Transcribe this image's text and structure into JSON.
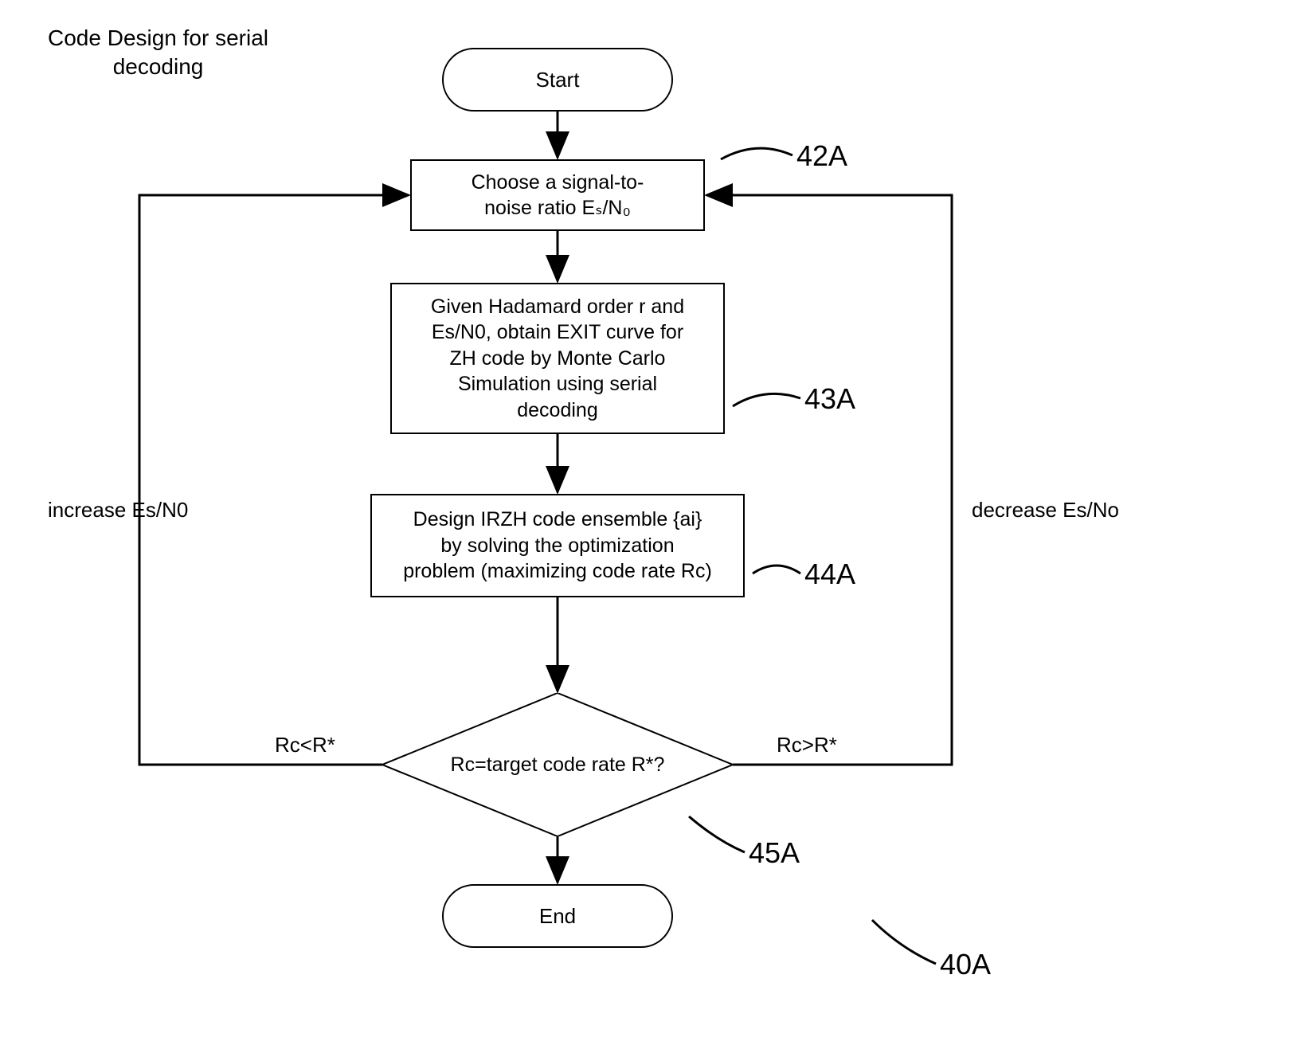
{
  "title": "Code Design for serial\ndecoding",
  "nodes": {
    "start": "Start",
    "step42A": "Choose a signal-to-\nnoise ratio  Eₛ/N₀",
    "step43A": "Given Hadamard order r and\nEs/N0, obtain EXIT curve for\nZH code by Monte Carlo\nSimulation using serial\ndecoding",
    "step44A": "Design IRZH code ensemble {ai}\nby solving the optimization\nproblem (maximizing code rate Rc)",
    "decision45A": "Rc=target code rate R*?",
    "end": "End"
  },
  "edgeLabels": {
    "leftLoop": "increase Es/N0",
    "rightLoop": "decrease Es/No",
    "leftCond": "Rc<R*",
    "rightCond": "Rc>R*"
  },
  "refs": {
    "r42A": "42A",
    "r43A": "43A",
    "r44A": "44A",
    "r45A": "45A",
    "r40A": "40A"
  }
}
